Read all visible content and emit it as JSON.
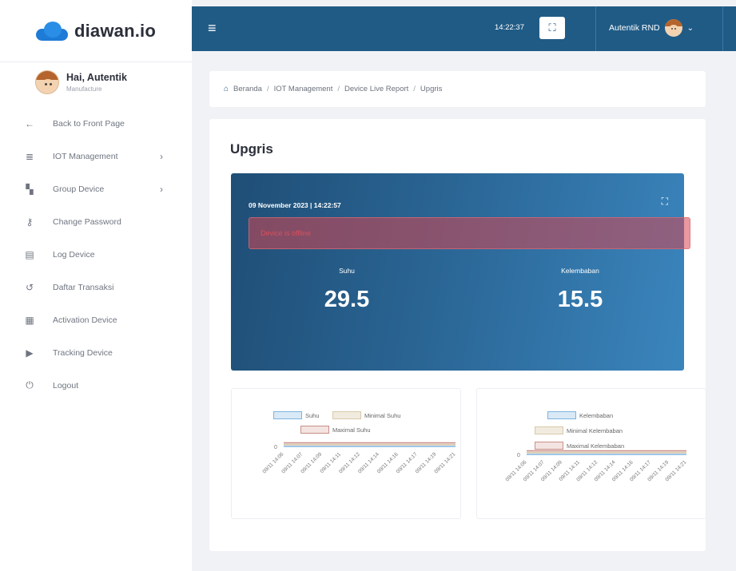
{
  "brand": {
    "name": "diawan.io"
  },
  "user": {
    "greeting": "Hai, Autentik",
    "role": "Manufacture"
  },
  "sidebar": {
    "items": [
      {
        "label": "Back to Front Page",
        "icon": "arrow-left-icon",
        "glyph": "←"
      },
      {
        "label": "IOT Management",
        "icon": "database-icon",
        "glyph": "≣",
        "has_chevron": true
      },
      {
        "label": "Group Device",
        "icon": "group-icon",
        "glyph": "▚",
        "has_chevron": true
      },
      {
        "label": "Change Password",
        "icon": "key-icon",
        "glyph": "⚷"
      },
      {
        "label": "Log Device",
        "icon": "file-icon",
        "glyph": "▤"
      },
      {
        "label": "Daftar Transaksi",
        "icon": "history-icon",
        "glyph": "↺"
      },
      {
        "label": "Activation Device",
        "icon": "calendar-icon",
        "glyph": "▦"
      },
      {
        "label": "Tracking Device",
        "icon": "truck-icon",
        "glyph": "▶"
      },
      {
        "label": "Logout",
        "icon": "power-icon",
        "glyph": "⏻"
      }
    ]
  },
  "topbar": {
    "time": "14:22:37",
    "account_name": "Autentik RND",
    "hamburger_glyph": "≡",
    "fullscreen_glyph": "⛶",
    "caret_glyph": "⌄"
  },
  "breadcrumb": {
    "items": [
      "Beranda",
      "IOT Management",
      "Device Live Report",
      "Upgris"
    ],
    "separator": "/"
  },
  "page": {
    "title": "Upgris"
  },
  "live": {
    "datetime": "09 November 2023 | 14:22:57",
    "alert_text": "Device is offline",
    "metrics": [
      {
        "label": "Suhu",
        "value": "29.5"
      },
      {
        "label": "Kelembaban",
        "value": "15.5"
      }
    ]
  },
  "colors": {
    "topbar": "#205b86",
    "series_value": "#7fb3e0",
    "series_min": "#d8c8a8",
    "series_max": "#c98f87"
  },
  "chart_data": [
    {
      "type": "line",
      "y_tick": "0",
      "legend": [
        "Suhu",
        "Minimal Suhu",
        "Maximal Suhu"
      ],
      "x": [
        "09/11 14:06",
        "09/11 14:07",
        "09/11 14:09",
        "09/11 14:11",
        "09/11 14:12",
        "09/11 14:14",
        "09/11 14:16",
        "09/11 14:17",
        "09/11 14:19",
        "09/11 14:21"
      ],
      "series": [
        {
          "name": "Suhu",
          "values": [
            0,
            0,
            0,
            0,
            0,
            0,
            0,
            0,
            0,
            0
          ]
        },
        {
          "name": "Minimal Suhu",
          "values": [
            0,
            0,
            0,
            0,
            0,
            0,
            0,
            0,
            0,
            0
          ]
        },
        {
          "name": "Maximal Suhu",
          "values": [
            0,
            0,
            0,
            0,
            0,
            0,
            0,
            0,
            0,
            0
          ]
        }
      ]
    },
    {
      "type": "line",
      "y_tick": "0",
      "legend": [
        "Kelembaban",
        "Minimal Kelembaban",
        "Maximal Kelembaban"
      ],
      "x": [
        "09/11 14:06",
        "09/11 14:07",
        "09/11 14:09",
        "09/11 14:11",
        "09/11 14:12",
        "09/11 14:14",
        "09/11 14:16",
        "09/11 14:17",
        "09/11 14:19",
        "09/11 14:21"
      ],
      "series": [
        {
          "name": "Kelembaban",
          "values": [
            0,
            0,
            0,
            0,
            0,
            0,
            0,
            0,
            0,
            0
          ]
        },
        {
          "name": "Minimal Kelembaban",
          "values": [
            0,
            0,
            0,
            0,
            0,
            0,
            0,
            0,
            0,
            0
          ]
        },
        {
          "name": "Maximal Kelembaban",
          "values": [
            0,
            0,
            0,
            0,
            0,
            0,
            0,
            0,
            0,
            0
          ]
        }
      ]
    }
  ]
}
